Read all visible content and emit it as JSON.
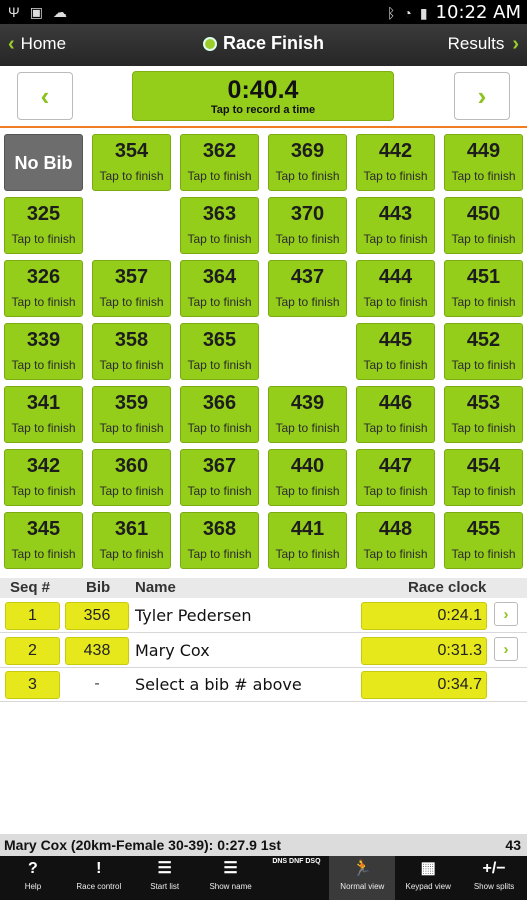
{
  "status_bar": {
    "time": "10:22 AM"
  },
  "header": {
    "home_label": "Home",
    "title": "Race Finish",
    "results_label": "Results"
  },
  "timer": {
    "value": "0:40.4",
    "subtitle": "Tap to record a time"
  },
  "grid": {
    "no_bib_label": "No Bib",
    "tap_label": "Tap to finish",
    "rows": [
      [
        "NOBIB",
        "354",
        "362",
        "369",
        "442",
        "449"
      ],
      [
        "325",
        "",
        "363",
        "370",
        "443",
        "450"
      ],
      [
        "326",
        "357",
        "364",
        "437",
        "444",
        "451"
      ],
      [
        "339",
        "358",
        "365",
        "",
        "445",
        "452"
      ],
      [
        "341",
        "359",
        "366",
        "439",
        "446",
        "453"
      ],
      [
        "342",
        "360",
        "367",
        "440",
        "447",
        "454"
      ],
      [
        "345",
        "361",
        "368",
        "441",
        "448",
        "455"
      ]
    ]
  },
  "table": {
    "headers": {
      "seq": "Seq #",
      "bib": "Bib",
      "name": "Name",
      "clock": "Race clock"
    },
    "rows": [
      {
        "seq": "1",
        "bib": "356",
        "name": "Tyler Pedersen",
        "clock": "0:24.1",
        "has_arrow": true
      },
      {
        "seq": "2",
        "bib": "438",
        "name": "Mary Cox",
        "clock": "0:31.3",
        "has_arrow": true
      },
      {
        "seq": "3",
        "bib": "-",
        "name": "Select a bib # above",
        "clock": "0:34.7",
        "has_arrow": false
      }
    ]
  },
  "footer_status": {
    "text": "Mary Cox (20km-Female 30-39): 0:27.9 1st",
    "count": "43"
  },
  "toolbar": {
    "items": [
      {
        "icon": "?",
        "label": "Help",
        "icon_name": "help-icon"
      },
      {
        "icon": "!",
        "label": "Race control",
        "icon_name": "race-control-icon"
      },
      {
        "icon": "☰",
        "label": "Start list",
        "icon_name": "start-list-icon"
      },
      {
        "icon": "☰",
        "label": "Show name",
        "icon_name": "show-name-icon"
      },
      {
        "icon": "DNS DNF DSQ",
        "label": "",
        "icon_name": "dns-dnf-dsq-icon"
      },
      {
        "icon": "🏃",
        "label": "Normal view",
        "icon_name": "normal-view-icon",
        "active": true
      },
      {
        "icon": "▦",
        "label": "Keypad view",
        "icon_name": "keypad-view-icon"
      },
      {
        "icon": "+/−",
        "label": "Show splits",
        "icon_name": "show-splits-icon"
      }
    ]
  },
  "colors": {
    "accent": "#94cd1a",
    "highlight": "#e6e81c",
    "divider": "#f07d22"
  }
}
